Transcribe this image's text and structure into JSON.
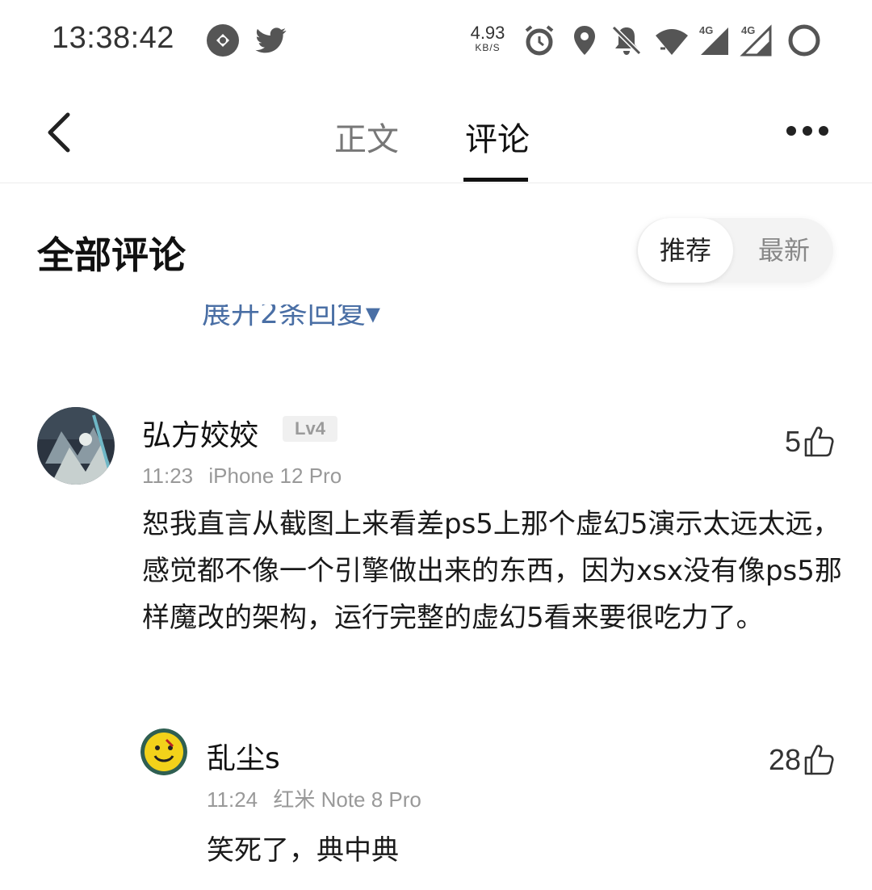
{
  "status_bar": {
    "time": "13:38:42",
    "net_speed_value": "4.93",
    "net_speed_unit": "KB/S",
    "icons": [
      "qq-browser-icon",
      "twitter-icon",
      "alarm-icon",
      "location-icon",
      "mute-icon",
      "wifi-icon",
      "signal-4g-icon",
      "signal-4g-icon",
      "battery-ring-icon"
    ]
  },
  "header": {
    "tabs": [
      {
        "label": "正文"
      },
      {
        "label": "评论"
      }
    ],
    "active_tab": "评论"
  },
  "section": {
    "title": "全部评论",
    "sort_options": [
      "推荐",
      "最新"
    ],
    "selected_sort": "推荐"
  },
  "expand_replies": "展开2条回复▾",
  "comment": {
    "username": "弘方姣姣",
    "level": "Lv4",
    "time": "11:23",
    "device": "iPhone 12 Pro",
    "likes": "5",
    "text": "恕我直言从截图上来看差ps5上那个虚幻5演示太远太远，感觉都不像一个引擎做出来的东西，因为xsx没有像ps5那样魔改的架构，运行完整的虚幻5看来要很吃力了。",
    "reply": {
      "username": "乱尘s",
      "time": "11:24",
      "device": "红米 Note 8 Pro",
      "likes": "28",
      "text": "笑死了，典中典"
    }
  },
  "colors": {
    "accent_text": "#111111",
    "muted": "#999999",
    "link_blue": "#4a6fa5"
  }
}
